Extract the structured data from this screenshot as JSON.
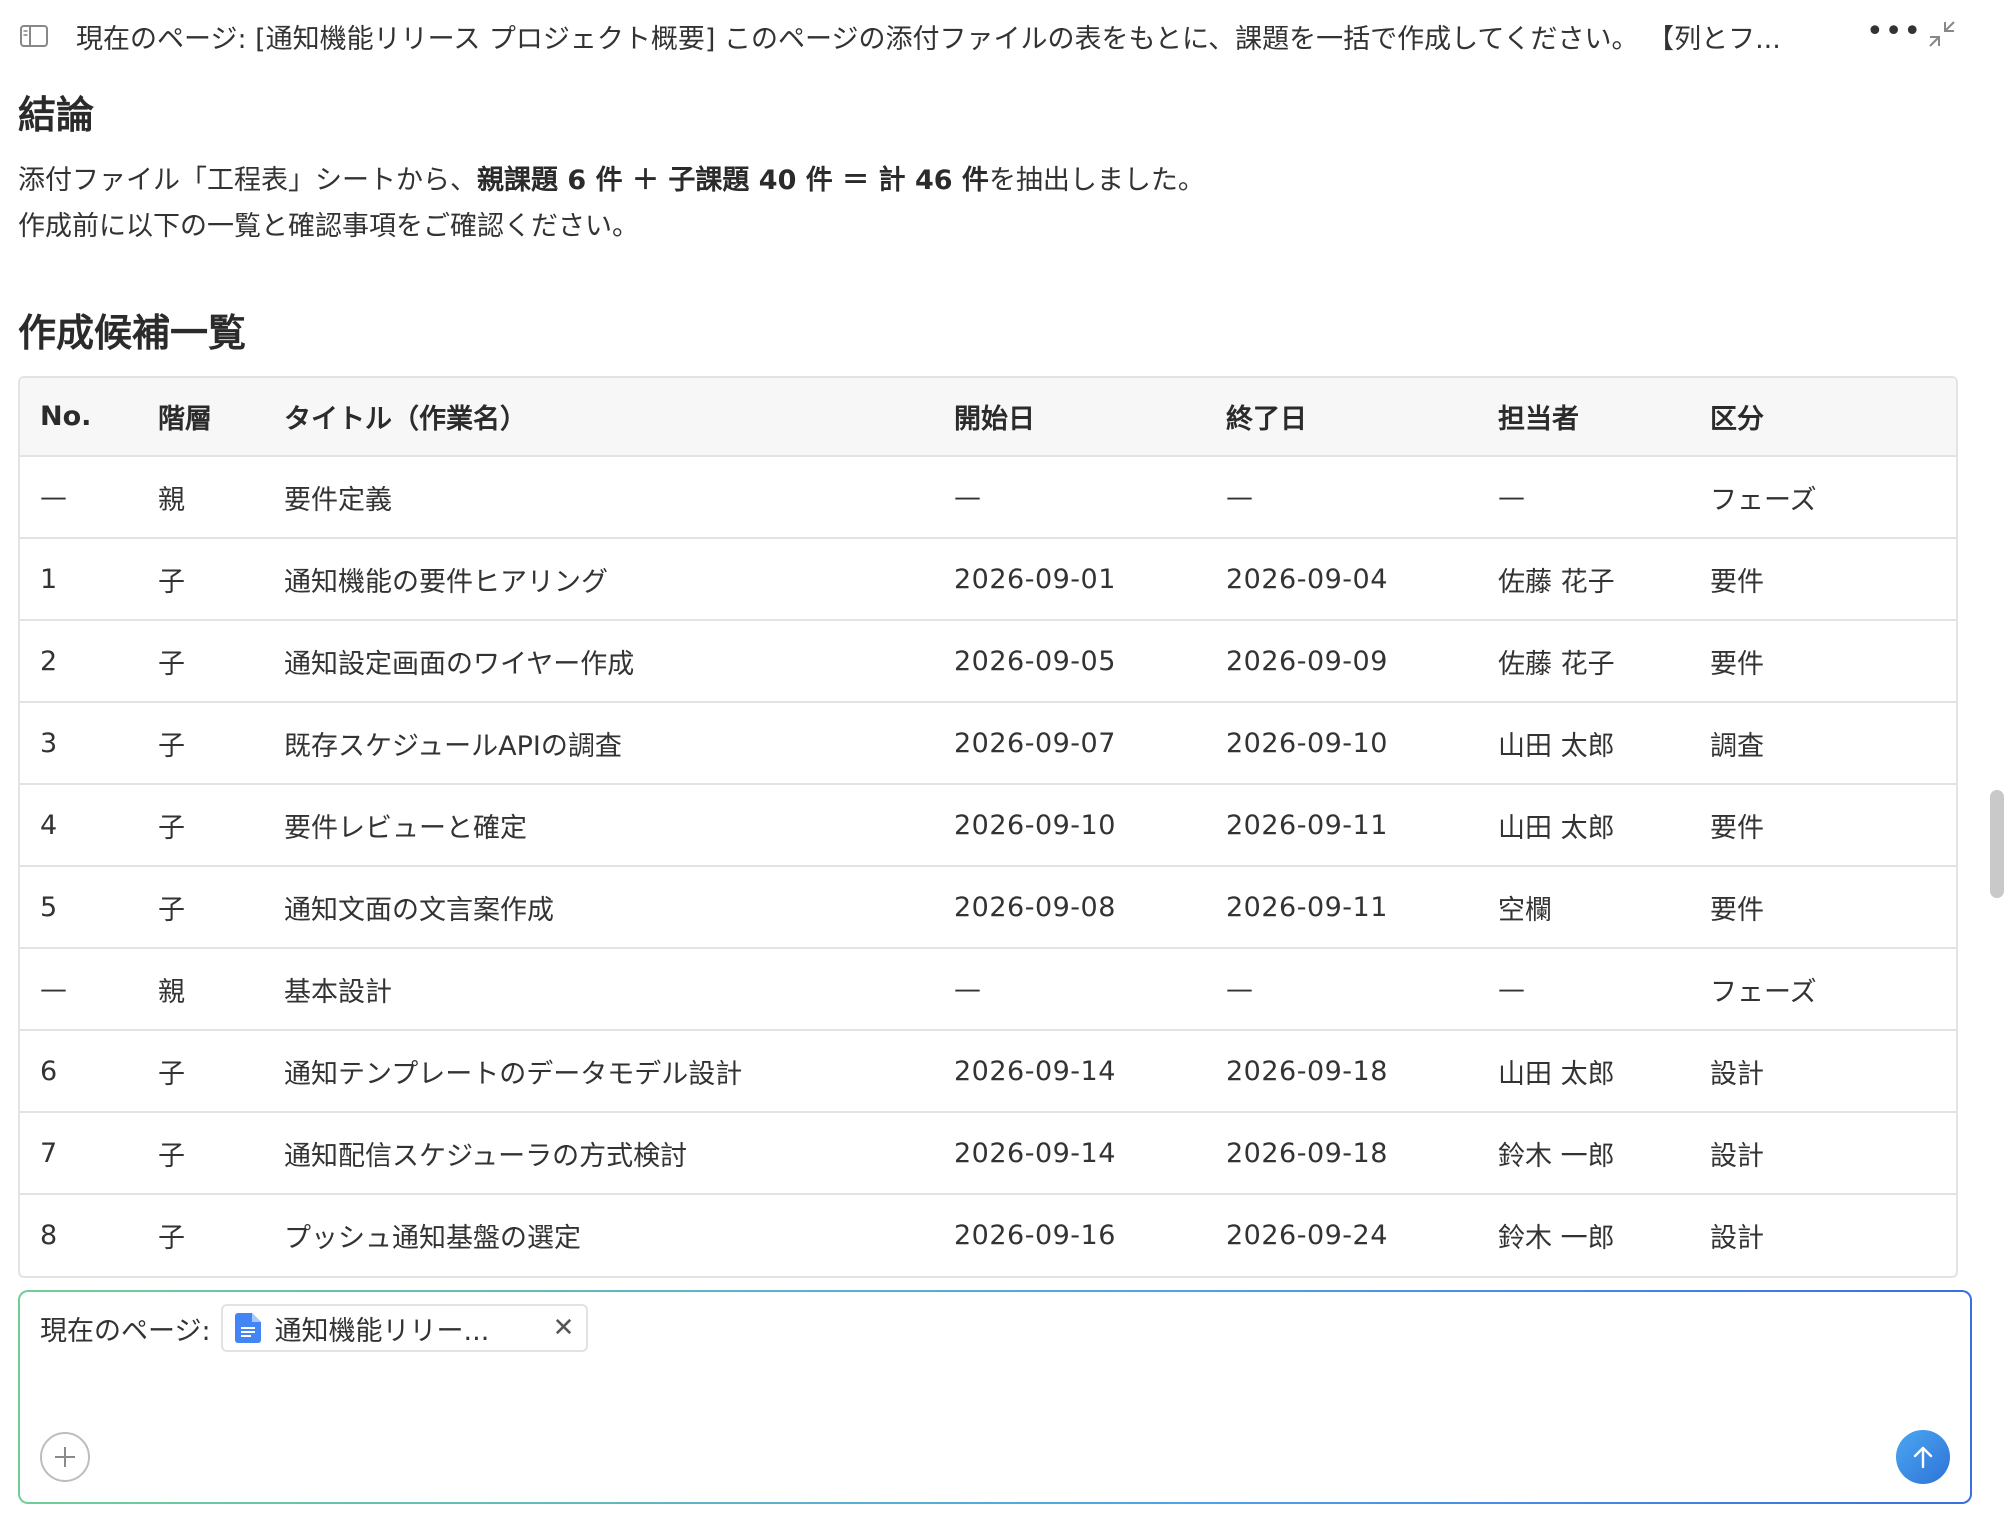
{
  "header": {
    "title": "現在のページ: [通知機能リリース プロジェクト概要] このページの添付ファイルの表をもとに、課題を一括で作成してください。 【列とフ..."
  },
  "conclusion": {
    "heading": "結論",
    "line1_pre": "添付ファイル「工程表」シートから、",
    "line1_bold": "親課題 6 件 ＋ 子課題 40 件 ＝ 計 46 件",
    "line1_post": "を抽出しました。",
    "line2": "作成前に以下の一覧と確認事項をご確認ください。"
  },
  "candidates": {
    "heading": "作成候補一覧",
    "columns": [
      "No.",
      "階層",
      "タイトル（作業名）",
      "開始日",
      "終了日",
      "担当者",
      "区分"
    ],
    "rows": [
      [
        "—",
        "親",
        "要件定義",
        "—",
        "—",
        "—",
        "フェーズ"
      ],
      [
        "1",
        "子",
        "通知機能の要件ヒアリング",
        "2026-09-01",
        "2026-09-04",
        "佐藤 花子",
        "要件"
      ],
      [
        "2",
        "子",
        "通知設定画面のワイヤー作成",
        "2026-09-05",
        "2026-09-09",
        "佐藤 花子",
        "要件"
      ],
      [
        "3",
        "子",
        "既存スケジュールAPIの調査",
        "2026-09-07",
        "2026-09-10",
        "山田 太郎",
        "調査"
      ],
      [
        "4",
        "子",
        "要件レビューと確定",
        "2026-09-10",
        "2026-09-11",
        "山田 太郎",
        "要件"
      ],
      [
        "5",
        "子",
        "通知文面の文言案作成",
        "2026-09-08",
        "2026-09-11",
        "空欄",
        "要件"
      ],
      [
        "—",
        "親",
        "基本設計",
        "—",
        "—",
        "—",
        "フェーズ"
      ],
      [
        "6",
        "子",
        "通知テンプレートのデータモデル設計",
        "2026-09-14",
        "2026-09-18",
        "山田 太郎",
        "設計"
      ],
      [
        "7",
        "子",
        "通知配信スケジューラの方式検討",
        "2026-09-14",
        "2026-09-18",
        "鈴木 一郎",
        "設計"
      ],
      [
        "8",
        "子",
        "プッシュ通知基盤の選定",
        "2026-09-16",
        "2026-09-24",
        "鈴木 一郎",
        "設計"
      ]
    ]
  },
  "composer": {
    "label": "現在のページ:",
    "chip_text": "通知機能リリー...",
    "chip_icon": "document-icon",
    "close_glyph": "✕"
  },
  "icons": {
    "more": "more-icon",
    "collapse": "collapse-icon",
    "sidebar": "sidebar-toggle-icon",
    "add": "plus-icon",
    "send": "arrow-up-icon"
  },
  "colors": {
    "send_button": "#3a86e6",
    "doc_icon": "#4285f4",
    "composer_border_start": "#6fcf97",
    "composer_border_end": "#3a6fe0"
  }
}
